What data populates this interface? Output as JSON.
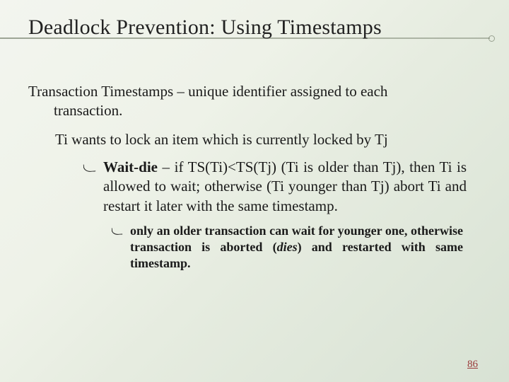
{
  "title": "Deadlock Prevention: Using Timestamps",
  "para1": {
    "term": "Transaction Timestamps",
    "rest1": " – unique identifier assigned to each",
    "rest2": "transaction."
  },
  "para2": "Ti wants to lock an item which is currently locked by Tj",
  "bullet1": {
    "term": "Wait-die",
    "rest": " – if TS(Ti)<TS(Tj) (Ti is older than Tj), then Ti is allowed to wait; otherwise (Ti younger than Tj) abort Ti and restart it later with the same timestamp."
  },
  "bullet2": {
    "pre": "only an older transaction can wait for younger one, otherwise transaction is aborted (",
    "em": "dies",
    "post": ") and restarted with same timestamp."
  },
  "page_number": "86"
}
